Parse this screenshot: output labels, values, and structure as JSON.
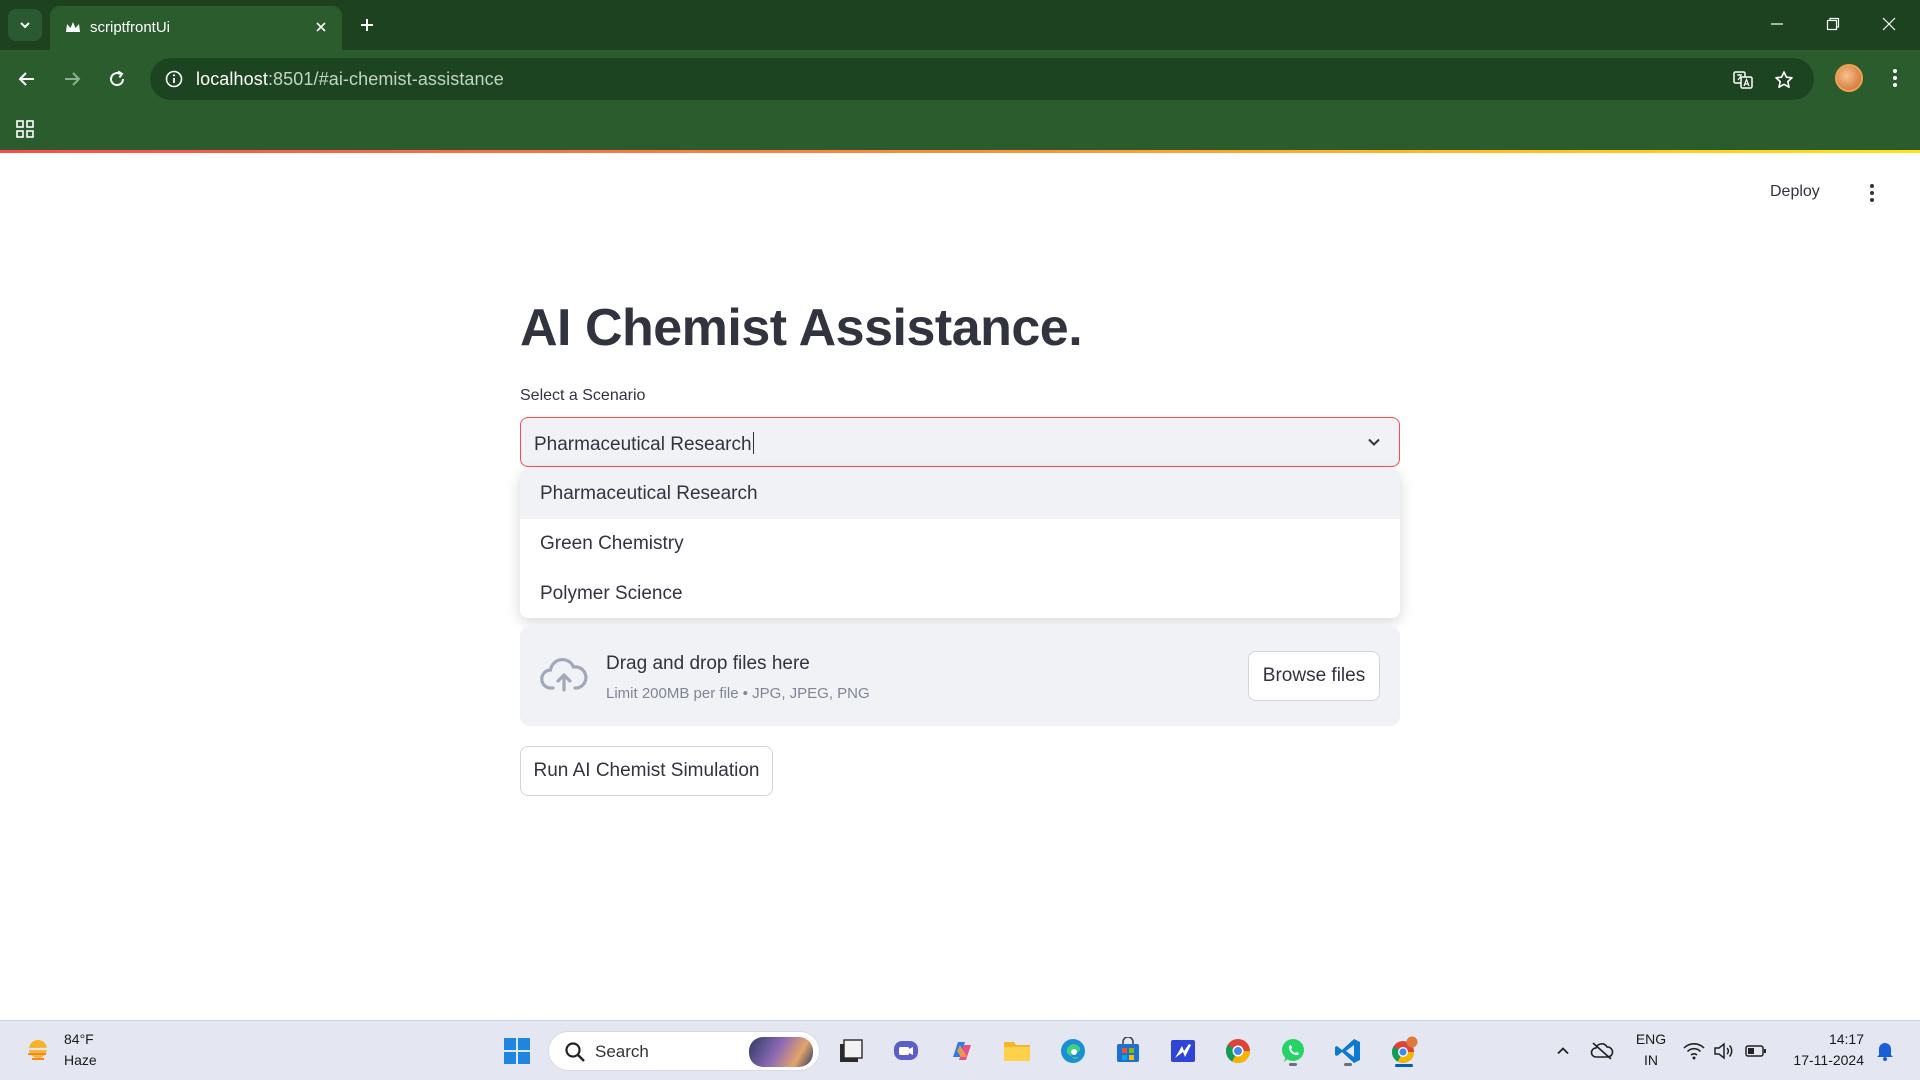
{
  "browser": {
    "tab_title": "scriptfrontUi",
    "url_host": "localhost",
    "url_path": ":8501/#ai-chemist-assistance"
  },
  "app": {
    "deploy_label": "Deploy",
    "title": "AI Chemist Assistance.",
    "select_label": "Select a Scenario",
    "select_value": "Pharmaceutical Research",
    "dropdown_options": [
      "Pharmaceutical Research",
      "Green Chemistry",
      "Polymer Science"
    ],
    "uploader": {
      "main_text": "Drag and drop files here",
      "sub_text": "Limit 200MB per file • JPG, JPEG, PNG",
      "browse_label": "Browse files"
    },
    "run_button_label": "Run AI Chemist Simulation"
  },
  "taskbar": {
    "weather_temp": "84°F",
    "weather_cond": "Haze",
    "search_placeholder": "Search",
    "lang_top": "ENG",
    "lang_bottom": "IN",
    "time": "14:17",
    "date": "17-11-2024"
  },
  "colors": {
    "browser_frame": "#2a5c2d",
    "primary": "#ff4b4b",
    "text": "#31333f",
    "muted_text": "#808495",
    "panel_bg": "#f0f2f6"
  }
}
